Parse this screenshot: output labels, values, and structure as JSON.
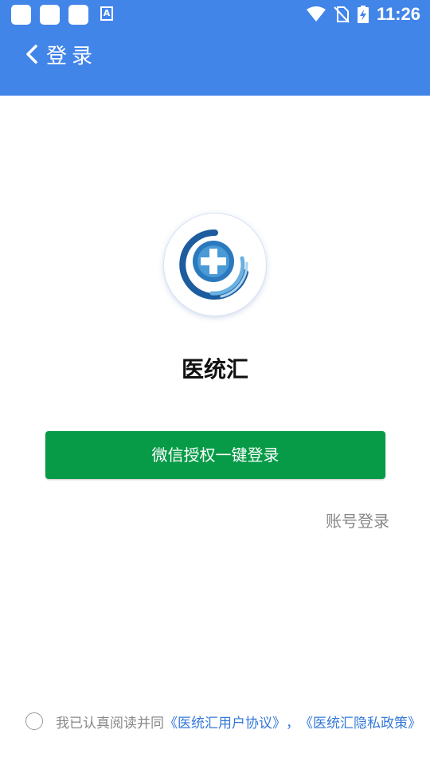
{
  "status_bar": {
    "time": "11:26",
    "a_icon_label": "A"
  },
  "nav": {
    "title": "登录"
  },
  "app": {
    "name": "医统汇"
  },
  "buttons": {
    "wechat_login": "微信授权一键登录",
    "account_login": "账号登录"
  },
  "agreement": {
    "prefix": "我已认真阅读并同",
    "user_agreement": "《医统汇用户协议》",
    "separator": "，",
    "privacy_policy": "《医统汇隐私政策》"
  },
  "colors": {
    "header": "#4285e9",
    "wechat_green": "#079b47",
    "link_blue": "#3478d8"
  }
}
